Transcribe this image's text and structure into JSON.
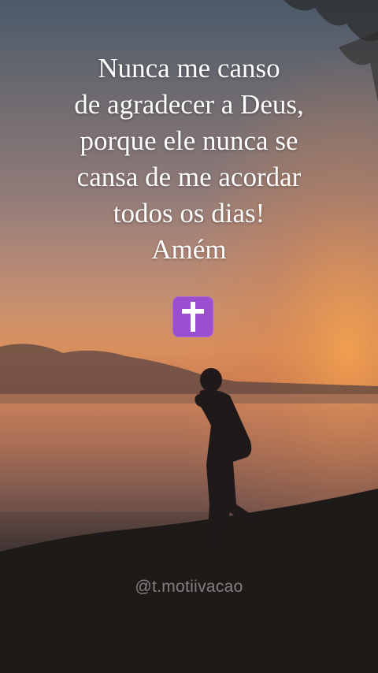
{
  "quote": {
    "lines": [
      "Nunca me canso",
      "de agradecer a Deus,",
      "porque ele nunca se",
      "cansa de me acordar",
      "todos os dias!",
      "Amém"
    ]
  },
  "emoji": {
    "icon": "latin-cross-icon",
    "color": "#9b4fd0"
  },
  "watermark": {
    "text": "@t.motiivacao"
  }
}
